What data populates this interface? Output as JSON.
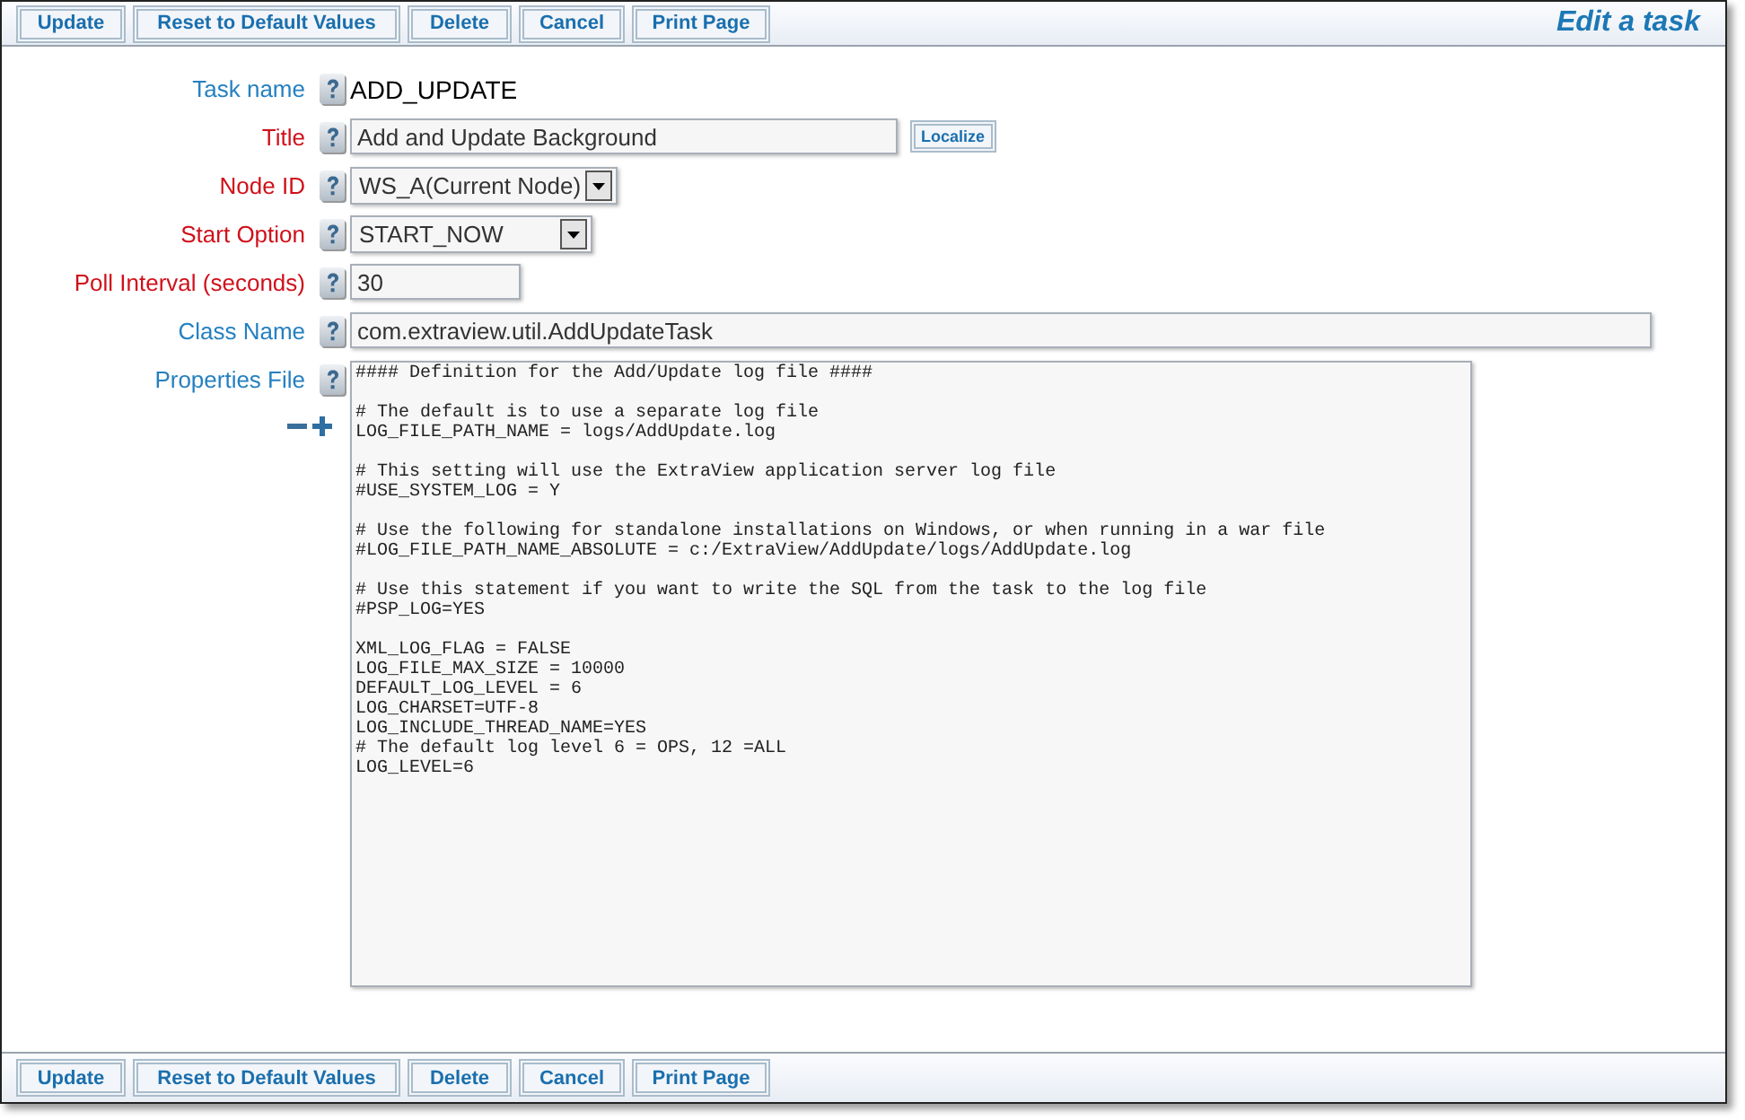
{
  "toolbar_top": [
    "Update",
    "Reset to Default Values",
    "Delete",
    "Cancel",
    "Print Page"
  ],
  "page_title": "Edit a task",
  "fields": [
    {
      "label": "Task name",
      "required": false,
      "kind": "text",
      "value": "ADD_UPDATE"
    },
    {
      "label": "Title",
      "required": true,
      "kind": "input",
      "value": "Add and Update Background",
      "button": "Localize"
    },
    {
      "label": "Node ID",
      "required": true,
      "kind": "select",
      "value": "WS_A(Current Node)"
    },
    {
      "label": "Start Option",
      "required": true,
      "kind": "select",
      "value": "START_NOW"
    },
    {
      "label": "Poll Interval (seconds)",
      "required": true,
      "kind": "input",
      "value": "30"
    },
    {
      "label": "Class Name",
      "required": false,
      "kind": "input",
      "value": "com.extraview.util.AddUpdateTask"
    },
    {
      "label": "Properties File",
      "required": false,
      "kind": "textarea",
      "text": "#### Definition for the Add/Update log file ####\n\n# The default is to use a separate log file\nLOG_FILE_PATH_NAME = logs/AddUpdate.log\n\n# This setting will use the ExtraView application server log file\n#USE_SYSTEM_LOG = Y\n\n# Use the following for standalone installations on Windows, or when running in a war file\n#LOG_FILE_PATH_NAME_ABSOLUTE = c:/ExtraView/AddUpdate/logs/AddUpdate.log\n\n# Use this statement if you want to write the SQL from the task to the log file\n#PSP_LOG=YES\n\nXML_LOG_FLAG = FALSE\nLOG_FILE_MAX_SIZE = 10000\nDEFAULT_LOG_LEVEL = 6\nLOG_CHARSET=UTF-8\nLOG_INCLUDE_THREAD_NAME=YES\n# The default log level 6 = OPS, 12 =ALL\nLOG_LEVEL=6"
    }
  ],
  "toolbar_bottom": [
    "Update",
    "Reset to Default Values",
    "Delete",
    "Cancel",
    "Print Page"
  ]
}
